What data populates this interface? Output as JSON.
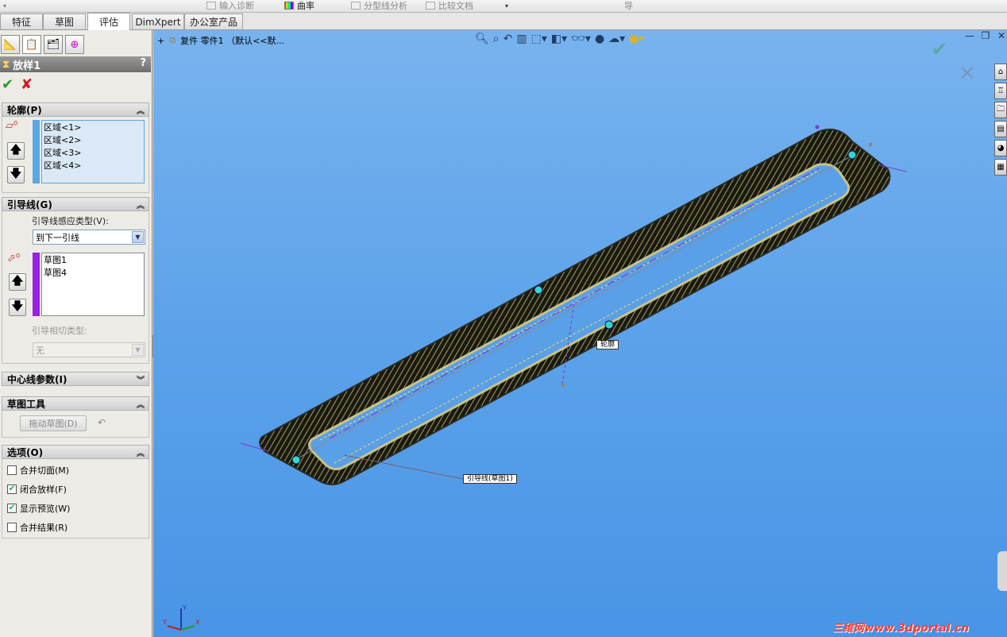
{
  "ribbon": {
    "items": [
      {
        "label": "输入诊断",
        "icon": "diagnostics-icon"
      },
      {
        "label": "曲率",
        "icon": "curvature-icon"
      },
      {
        "label": "分型线分析",
        "icon": "parting-line-icon"
      },
      {
        "label": "比较文档",
        "icon": "compare-icon"
      },
      {
        "label": "导",
        "icon": ""
      }
    ]
  },
  "tabs": [
    "特征",
    "草图",
    "评估",
    "DimXpert",
    "办公室产品"
  ],
  "active_tab": "评估",
  "feature": {
    "title": "放样1",
    "help": "?",
    "ok": "✔",
    "cancel": "✘"
  },
  "profile": {
    "header": "轮廓(P)",
    "items": [
      "区域<1>",
      "区域<2>",
      "区域<3>",
      "区域<4>"
    ]
  },
  "guides": {
    "header": "引导线(G)",
    "influence_label": "引导线感应类型(V):",
    "influence_value": "到下一引线",
    "items": [
      "草图1",
      "草图4"
    ],
    "tangency_label": "引导相切类型:",
    "tangency_value": "无"
  },
  "centerline": {
    "header": "中心线参数(I)"
  },
  "sketch_tools": {
    "header": "草图工具",
    "drag_button": "拖动草图(D)",
    "undo": "↶"
  },
  "options": {
    "header": "选项(O)",
    "items": [
      {
        "label": "合并切面(M)",
        "checked": false
      },
      {
        "label": "闭合放样(F)",
        "checked": true
      },
      {
        "label": "显示预览(W)",
        "checked": true
      },
      {
        "label": "合并结果(R)",
        "checked": false
      }
    ]
  },
  "viewport": {
    "tree_expand": "+",
    "tree_text": "复件 零件1 （默认<<默...",
    "callout_profile": "轮廓",
    "callout_guide": "引导线(草图1)",
    "watermark": "三维网www.3dportal.cn",
    "bg_top": "#78b3ee",
    "bg_bottom": "#4a94e6"
  },
  "colors": {
    "profile_bar": "#59a7e6",
    "guide_bar": "#9b1fe8",
    "accent_ok": "#2a9a2a",
    "accent_cancel": "#d21b1b"
  }
}
